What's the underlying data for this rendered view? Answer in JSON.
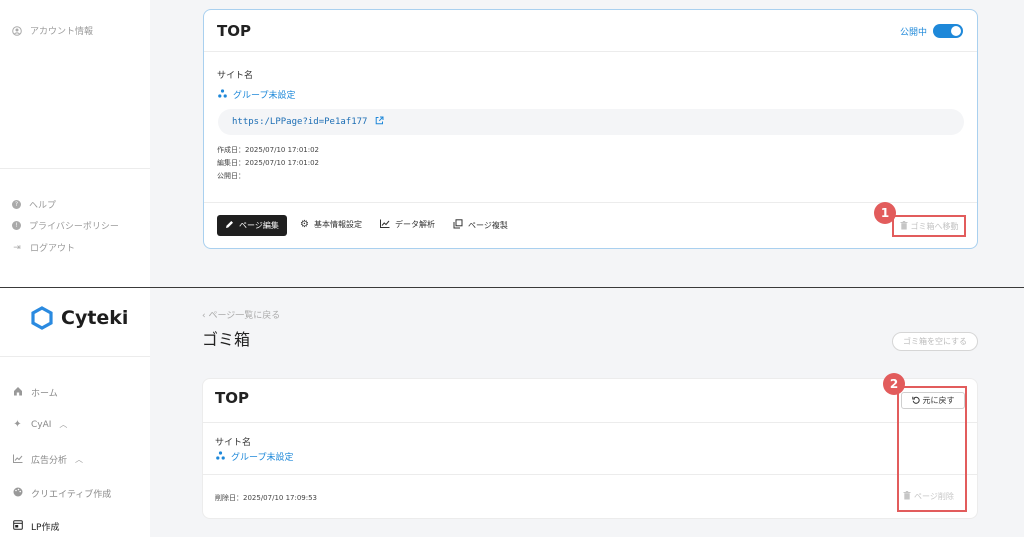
{
  "top": {
    "sidebar": {
      "account": "アカウント情報",
      "help": "ヘルプ",
      "privacy": "プライバシーポリシー",
      "logout": "ログアウト"
    },
    "card": {
      "title": "TOP",
      "status_label": "公開中",
      "site_name_label": "サイト名",
      "group_link": "グループ未設定",
      "url": "https:/LPPage?id=Pe1af177",
      "created": "作成日：2025/07/10 17:01:02",
      "edited": "編集日：2025/07/10 17:01:02",
      "published": "公開日：",
      "actions": {
        "edit": "ページ編集",
        "basic_settings": "基本情報設定",
        "data_analysis": "データ解析",
        "copy_page": "ページ複製",
        "move_to_trash": "ゴミ箱へ移動"
      }
    },
    "badge": "1"
  },
  "bottom": {
    "sidebar": {
      "logo": "Cyteki",
      "nav": [
        {
          "label": "ホーム",
          "icon": "home-icon"
        },
        {
          "label": "CyAI",
          "icon": "sparkle-icon"
        },
        {
          "label": "広告分析",
          "icon": "chart-icon"
        },
        {
          "label": "クリエイティブ作成",
          "icon": "palette-icon"
        },
        {
          "label": "LP作成",
          "icon": "lp-icon"
        }
      ]
    },
    "back_link": "ページ一覧に戻る",
    "page_title": "ゴミ箱",
    "empty_trash": "ゴミ箱を空にする",
    "card": {
      "title": "TOP",
      "restore": "元に戻す",
      "site_name_label": "サイト名",
      "group_link": "グループ未設定",
      "deleted": "削除日：2025/07/10 17:09:53",
      "delete_page": "ページ削除"
    },
    "badge": "2"
  },
  "colors": {
    "accent": "#1e88d9",
    "annotation_red": "#e25c5c",
    "main_bg": "#f4f5f7"
  }
}
